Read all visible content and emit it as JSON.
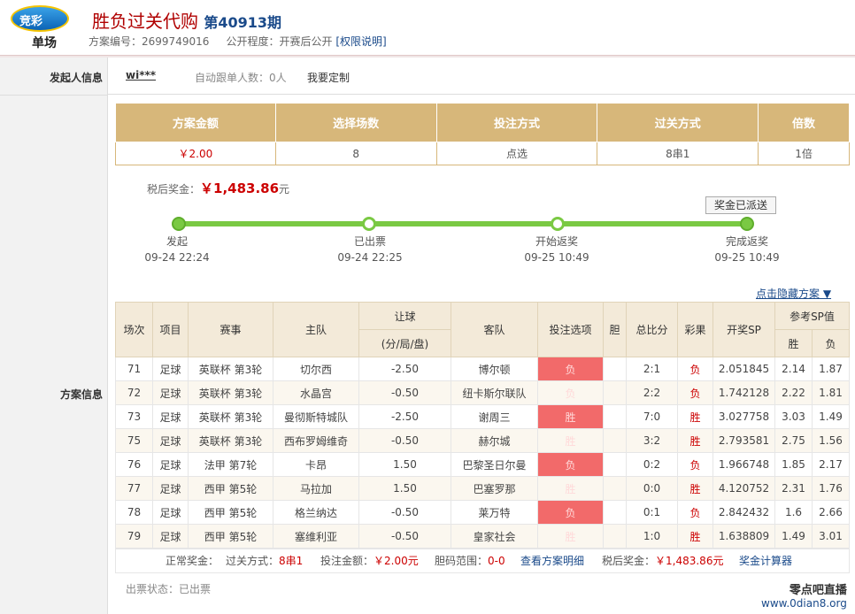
{
  "header": {
    "logo_text": "竞彩",
    "logo_sub": "单场",
    "title": "胜负过关代购",
    "issue": "第40913期",
    "plan_no_label": "方案编号：",
    "plan_no": "2699749016",
    "public_label": "公开程度：",
    "public_value": "开赛后公开",
    "perm_link": "[权限说明]"
  },
  "left": {
    "sponsor_label": "发起人信息",
    "plan_label": "方案信息"
  },
  "sponsor": {
    "user": "wi***",
    "follow_text": "自动跟单人数：0人",
    "custom_link": "我要定制"
  },
  "summary": {
    "headers": [
      "方案金额",
      "选择场数",
      "投注方式",
      "过关方式",
      "倍数"
    ],
    "values": [
      "￥2.00",
      "8",
      "点选",
      "8串1",
      "1倍"
    ]
  },
  "prize": {
    "label": "税后奖金：",
    "amount": "￥1,483.86",
    "unit": "元",
    "sent_button": "奖金已派送"
  },
  "timeline": [
    {
      "title": "发起",
      "time": "09-24 22:24"
    },
    {
      "title": "已出票",
      "time": "09-24 22:25"
    },
    {
      "title": "开始返奖",
      "time": "09-25 10:49"
    },
    {
      "title": "完成返奖",
      "time": "09-25 10:49"
    }
  ],
  "toggle_link": "点击隐藏方案 ▼",
  "detail": {
    "headers": {
      "round": "场次",
      "sport": "项目",
      "league": "赛事",
      "home": "主队",
      "handicap": "让球",
      "handicap_sub": "(分/局/盘)",
      "away": "客队",
      "pick": "投注选项",
      "dan": "胆",
      "score": "总比分",
      "result": "彩果",
      "sp": "开奖SP",
      "ref": "参考SP值",
      "win": "胜",
      "lose": "负"
    },
    "rows": [
      {
        "round": "71",
        "sport": "足球",
        "league": "英联杯 第3轮",
        "home": "切尔西",
        "handicap": "-2.50",
        "away": "博尔顿",
        "pick": "负",
        "dan": "",
        "score": "2:1",
        "result": "负",
        "sp": "2.051845",
        "win": "2.14",
        "lose": "1.87"
      },
      {
        "round": "72",
        "sport": "足球",
        "league": "英联杯 第3轮",
        "home": "水晶宫",
        "handicap": "-0.50",
        "away": "纽卡斯尔联队",
        "pick": "负",
        "dan": "",
        "score": "2:2",
        "result": "负",
        "sp": "1.742128",
        "win": "2.22",
        "lose": "1.81"
      },
      {
        "round": "73",
        "sport": "足球",
        "league": "英联杯 第3轮",
        "home": "曼彻斯特城队",
        "handicap": "-2.50",
        "away": "谢周三",
        "pick": "胜",
        "dan": "",
        "score": "7:0",
        "result": "胜",
        "sp": "3.027758",
        "win": "3.03",
        "lose": "1.49"
      },
      {
        "round": "75",
        "sport": "足球",
        "league": "英联杯 第3轮",
        "home": "西布罗姆维奇",
        "handicap": "-0.50",
        "away": "赫尔城",
        "pick": "胜",
        "dan": "",
        "score": "3:2",
        "result": "胜",
        "sp": "2.793581",
        "win": "2.75",
        "lose": "1.56"
      },
      {
        "round": "76",
        "sport": "足球",
        "league": "法甲 第7轮",
        "home": "卡昂",
        "handicap": "1.50",
        "away": "巴黎圣日尔曼",
        "pick": "负",
        "dan": "",
        "score": "0:2",
        "result": "负",
        "sp": "1.966748",
        "win": "1.85",
        "lose": "2.17"
      },
      {
        "round": "77",
        "sport": "足球",
        "league": "西甲 第5轮",
        "home": "马拉加",
        "handicap": "1.50",
        "away": "巴塞罗那",
        "pick": "胜",
        "dan": "",
        "score": "0:0",
        "result": "胜",
        "sp": "4.120752",
        "win": "2.31",
        "lose": "1.76"
      },
      {
        "round": "78",
        "sport": "足球",
        "league": "西甲 第5轮",
        "home": "格兰纳达",
        "handicap": "-0.50",
        "away": "莱万特",
        "pick": "负",
        "dan": "",
        "score": "0:1",
        "result": "负",
        "sp": "2.842432",
        "win": "1.6",
        "lose": "2.66"
      },
      {
        "round": "79",
        "sport": "足球",
        "league": "西甲 第5轮",
        "home": "塞维利亚",
        "handicap": "-0.50",
        "away": "皇家社会",
        "pick": "胜",
        "dan": "",
        "score": "1:0",
        "result": "胜",
        "sp": "1.638809",
        "win": "1.49",
        "lose": "3.01"
      }
    ]
  },
  "footer": {
    "normal_prize": "正常奖金：",
    "pass_label": "过关方式：",
    "pass_value": "8串1",
    "bet_label": "投注金额：",
    "bet_value": "￥2.00元",
    "dan_label": "胆码范围：",
    "dan_value": "0-0",
    "detail_link": "查看方案明细",
    "after_tax_label": "税后奖金：",
    "after_tax_value": "￥1,483.86元",
    "calc_link": "奖金计算器"
  },
  "status": {
    "label": "出票状态：",
    "value": "已出票"
  },
  "watermark": {
    "line1": "零点吧直播",
    "line2": "www.0dian8.org"
  },
  "colors": {
    "accent_red": "#c00000",
    "gold_header": "#d7b77a",
    "pick_red": "#f26a6a",
    "progress_green": "#7ac943",
    "link_blue": "#1a4a8a"
  }
}
